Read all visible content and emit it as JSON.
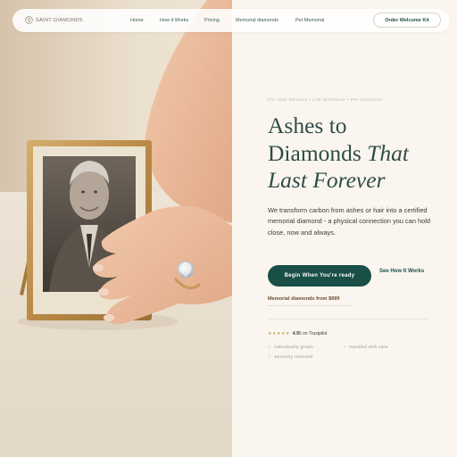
{
  "nav": {
    "brand": "SAINT DIAMONDS",
    "links": [
      "Home",
      "How it Works",
      "Pricing",
      "Memorial diamonds",
      "Pet Memorial"
    ],
    "cta": "Order Welcome Kit"
  },
  "hero": {
    "eyebrow": "For Your Memory • Life Milestone • Pet Sculpture",
    "headline_line1": "Ashes to",
    "headline_line2a": "Diamonds ",
    "headline_line2b": "That",
    "headline_line3": "Last Forever",
    "description": "We transform carbon from ashes or hair into a certified memorial diamond - a physical connection you can hold close, now and always.",
    "primary_button": "Begin When You're ready",
    "secondary_button": "See How It Works",
    "price_note": "Memorial diamonds from $999"
  },
  "rating": {
    "stars": "★★★★★",
    "score": "4.9",
    "source": "5 on Trustpilot"
  },
  "features": [
    "Individually grown",
    "Handled with care",
    "Securely returned"
  ],
  "colors": {
    "accent": "#1a4f47",
    "background": "#faf6ef",
    "headline": "#2f4d46",
    "star": "#c9a75a"
  }
}
